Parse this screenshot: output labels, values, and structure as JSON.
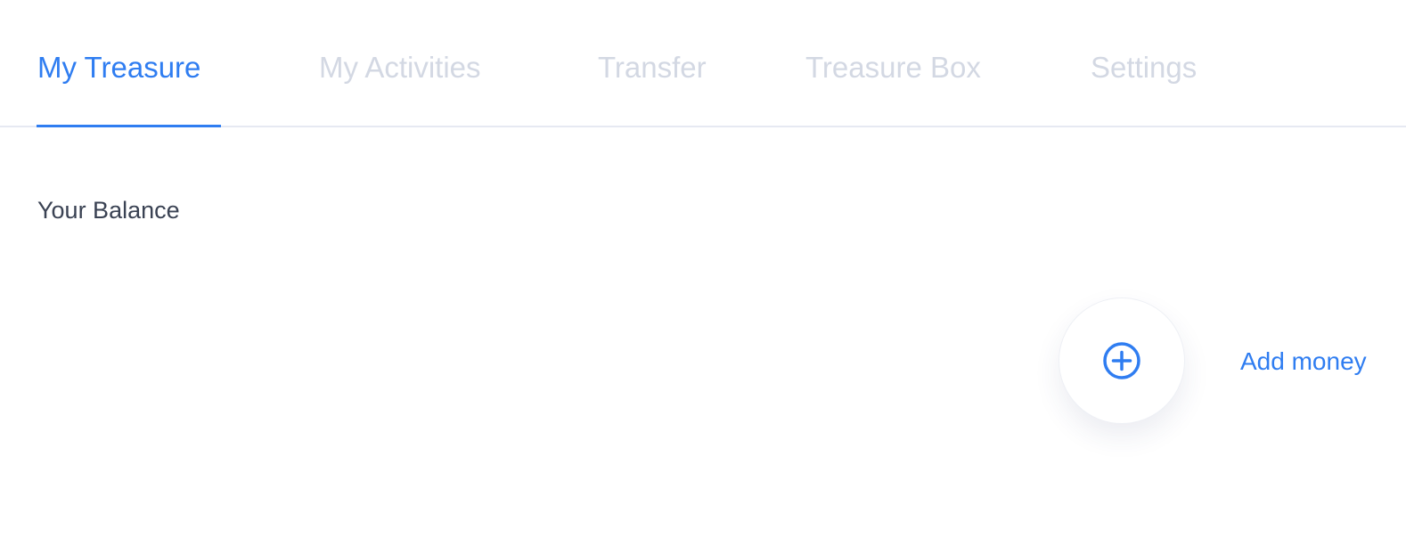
{
  "tabs": [
    {
      "label": "My Treasure",
      "active": true
    },
    {
      "label": "My Activities",
      "active": false
    },
    {
      "label": "Transfer",
      "active": false
    },
    {
      "label": "Treasure Box",
      "active": false
    },
    {
      "label": "Settings",
      "active": false
    }
  ],
  "balance": {
    "label": "Your Balance"
  },
  "actions": {
    "add_money_label": "Add money",
    "add_money_icon": "plus-circle-icon"
  },
  "colors": {
    "accent": "#2f7df1",
    "tab_inactive": "#d3d8e3",
    "text_dark": "#3a4253",
    "divider": "#e6e9f2"
  }
}
